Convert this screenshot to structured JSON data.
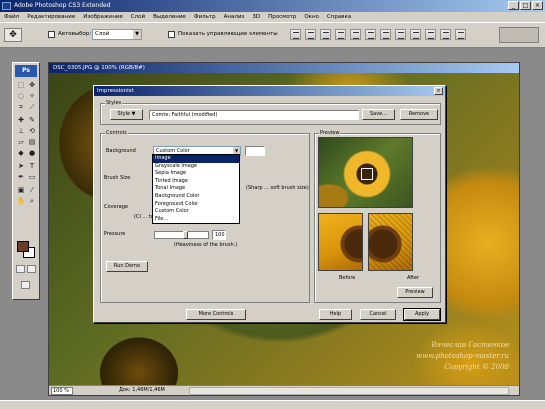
{
  "app": {
    "title": "Adobe Photoshop CS3 Extended",
    "window_buttons": [
      "_",
      "□",
      "×"
    ]
  },
  "menu": [
    "Файл",
    "Редактирование",
    "Изображение",
    "Слой",
    "Выделение",
    "Фильтр",
    "Анализ",
    "3D",
    "Просмотр",
    "Окно",
    "Справка"
  ],
  "options": {
    "autoselect_label": "Автовыбор:",
    "autoselect_value": "Слой",
    "show_controls_label": "Показать управляющие элементы"
  },
  "document": {
    "title": "DSC_0305.JPG @ 100% (RGB/8#)",
    "zoom": "100 %",
    "info": "Док: 1,46M/1,46M",
    "watermark_line1": "Вячеслав Гостенков",
    "watermark_line2": "www.photoshop-master.ru",
    "watermark_line3": "Copyright © 2008"
  },
  "dialog": {
    "title": "Impressionist",
    "style_group": "Styles",
    "style_button": "Style",
    "style_field": "Comte: Faithful (modified)",
    "save_button": "Save...",
    "remove_button": "Remove",
    "controls_group": "Controls",
    "background_label": "Background",
    "background_value": "Custom Color",
    "brush_size_label": "Brush Size",
    "brush_size_hint": "(Sharp ... soft brush size)",
    "coverage_label": "Coverage",
    "coverage_hint": "(Cl ... to cover.)",
    "pressure_label": "Pressure",
    "pressure_value": "100",
    "pressure_hint": "(Heaviness of the brush.)",
    "run_demo_button": "Run Demo",
    "more_controls_button": "More Controls",
    "help_button": "Help",
    "cancel_button": "Cancel",
    "apply_button": "Apply",
    "preview_group": "Preview",
    "before_label": "Before",
    "after_label": "After",
    "preview_button": "Preview",
    "background_options": [
      "Image",
      "Grayscale Image",
      "Sepia Image",
      "Tinted Image",
      "Tonal Image",
      "Background Color",
      "Foreground Color",
      "Custom Color",
      "File..."
    ],
    "selected_option_index": 0
  },
  "colors": {
    "foreground": "#6a3d24",
    "background": "#ffffff",
    "titlebar": "#0a246a"
  }
}
